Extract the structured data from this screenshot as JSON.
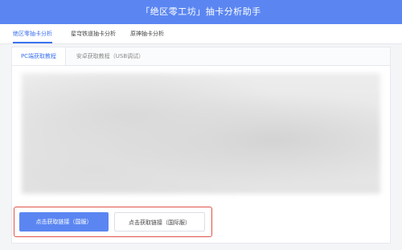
{
  "header": {
    "title": "「绝区零工坊」抽卡分析助手"
  },
  "main_tabs": [
    {
      "label": "绝区零抽卡分析"
    },
    {
      "label": "星穹铁道抽卡分析"
    },
    {
      "label": "原神抽卡分析"
    }
  ],
  "sub_tabs": [
    {
      "label": "PC端获取教程"
    },
    {
      "label": "安卓获取教程（USB调试）"
    }
  ],
  "buttons": {
    "cn_label": "点击获取链接（国服）",
    "global_label": "点击获取链接（国际服）"
  },
  "colors": {
    "accent": "#5b86f2",
    "highlight": "#e0534a"
  }
}
